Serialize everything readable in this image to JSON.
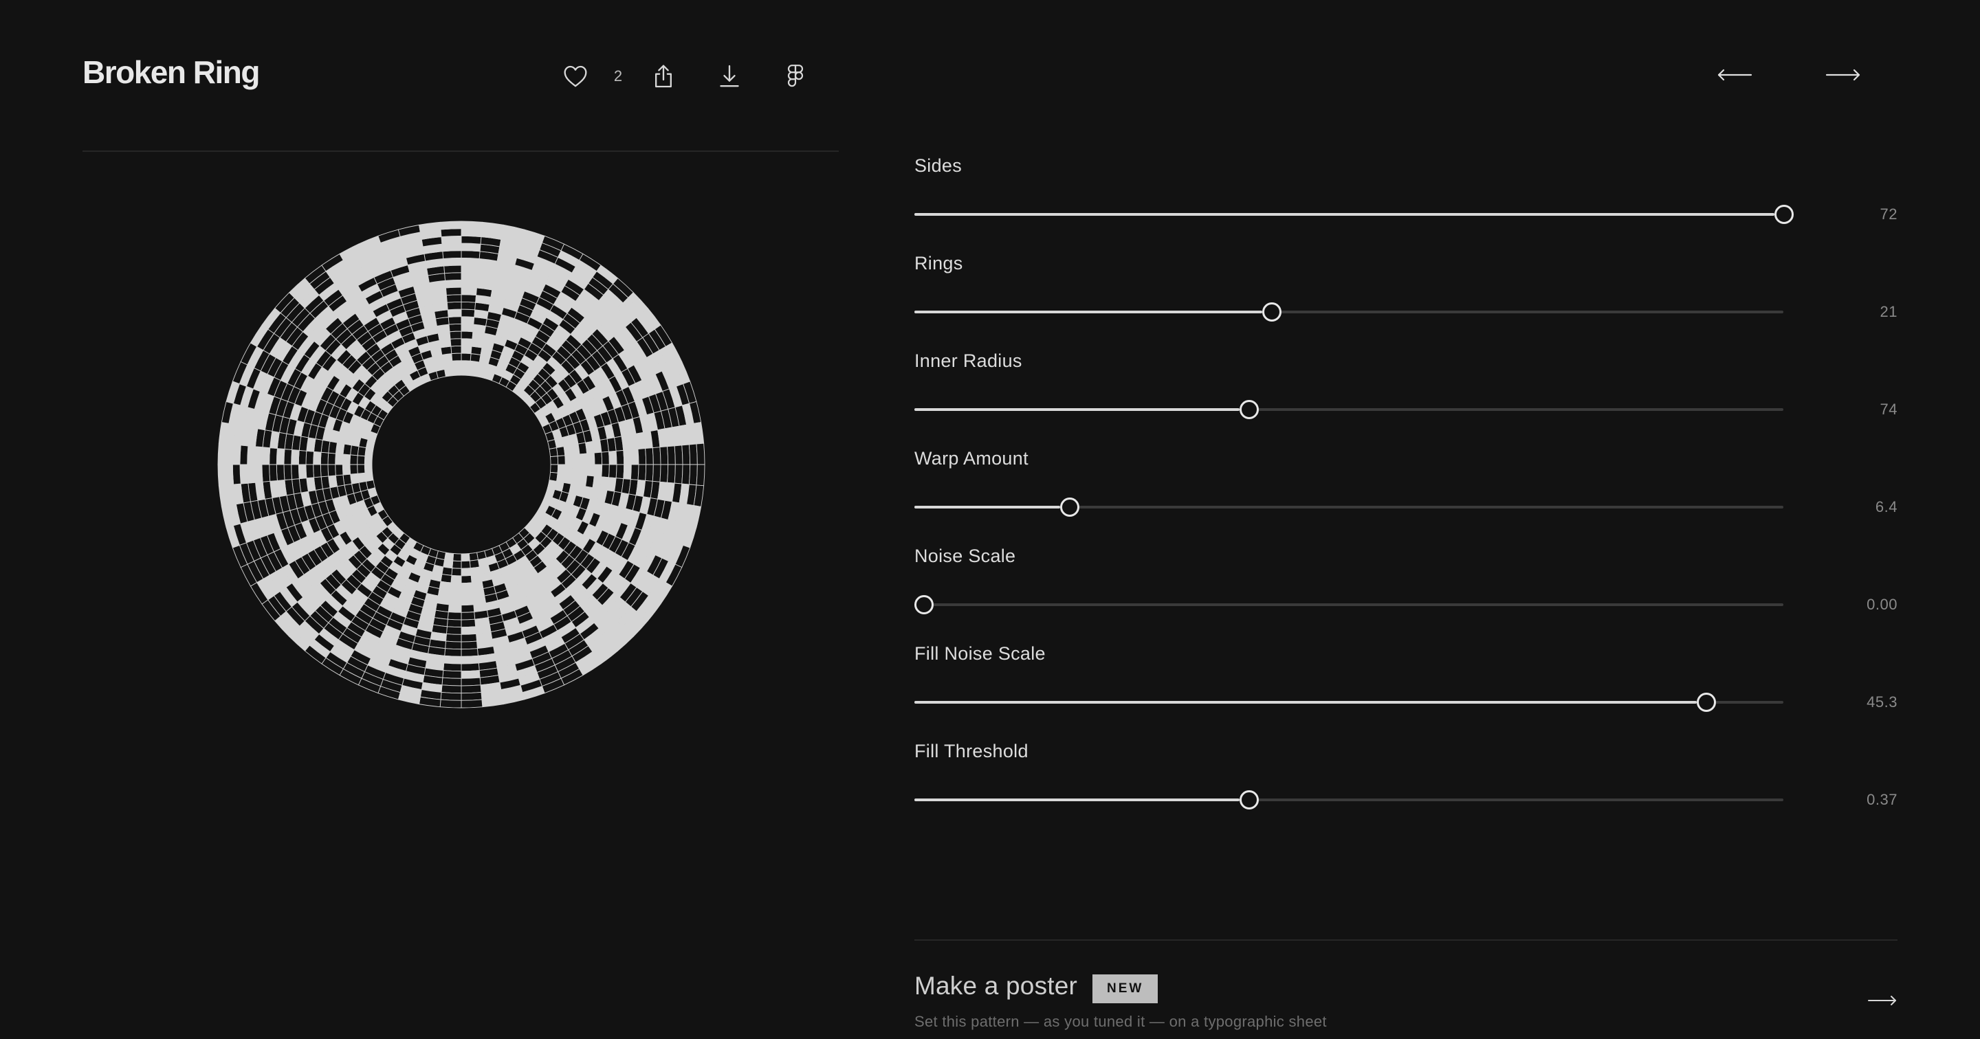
{
  "header": {
    "title": "Broken Ring",
    "like_count": "2"
  },
  "toolbar": {
    "icons": [
      "heart-icon",
      "share-icon",
      "download-icon",
      "figma-icon"
    ]
  },
  "navigation": {
    "prev_icon": "arrow-left-icon",
    "next_icon": "arrow-right-icon"
  },
  "pattern": {
    "sides": 72,
    "rings": 21,
    "fill_color": "#d4d4d4",
    "background_color": "#121212"
  },
  "controls": [
    {
      "label": "Sides",
      "value": "72",
      "level": 0.99
    },
    {
      "label": "Rings",
      "value": "21",
      "level": 0.4
    },
    {
      "label": "Inner Radius",
      "value": "74",
      "level": 0.374
    },
    {
      "label": "Warp Amount",
      "value": "6.4",
      "level": 0.168
    },
    {
      "label": "Noise Scale",
      "value": "0.00",
      "level": 0.0
    },
    {
      "label": "Fill Noise Scale",
      "value": "45.3",
      "level": 0.9
    },
    {
      "label": "Fill Threshold",
      "value": "0.37",
      "level": 0.374
    }
  ],
  "poster": {
    "title": "Make a poster",
    "badge": "NEW",
    "subtitle": "Set this pattern — as you tuned it — on a typographic sheet"
  },
  "colors": {
    "background": "#121212",
    "foreground": "#e0e0e0",
    "track": "#3a3a3a",
    "muted": "#8a8a8a"
  }
}
